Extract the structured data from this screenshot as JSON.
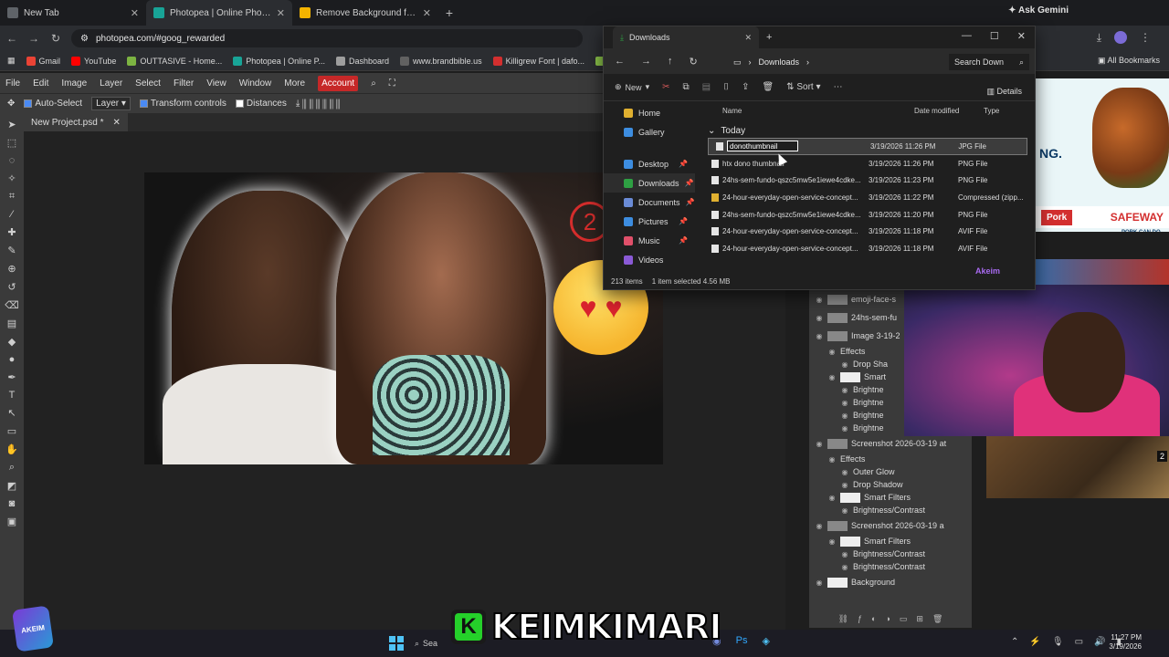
{
  "browser": {
    "tabs": [
      {
        "title": "New Tab",
        "color": "#5f6368"
      },
      {
        "title": "Photopea | Online Photo Editor",
        "color": "#18a497"
      },
      {
        "title": "Remove Background from Imag",
        "color": "#f4b400"
      }
    ],
    "gemini": "Ask Gemini",
    "url": "photopea.com/#goog_rewarded",
    "bookmarks": [
      {
        "label": "Gmail",
        "color": "#ea4335"
      },
      {
        "label": "YouTube",
        "color": "#ff0000"
      },
      {
        "label": "OUTTASIVE - Home...",
        "color": "#7cb342"
      },
      {
        "label": "Photopea | Online P...",
        "color": "#18a497"
      },
      {
        "label": "Dashboard",
        "color": "#9e9e9e"
      },
      {
        "label": "www.brandbible.us",
        "color": "#616161"
      },
      {
        "label": "Killigrew Font | dafo...",
        "color": "#d32f2f"
      },
      {
        "label": "3D Gif Mak",
        "color": "#8bc34a"
      }
    ],
    "all_bookmarks": "All Bookmarks"
  },
  "photopea": {
    "menu": [
      "File",
      "Edit",
      "Image",
      "Layer",
      "Select",
      "Filter",
      "View",
      "Window",
      "More"
    ],
    "account": "Account",
    "options": {
      "auto_select": "Auto-Select",
      "layer_select": "Layer",
      "transform_controls": "Transform controls",
      "distances": "Distances"
    },
    "doc_tab": "New Project.psd *"
  },
  "layers": [
    {
      "label": "emoji-face-s",
      "indent": 0,
      "kind": "layer"
    },
    {
      "label": "24hs-sem-fu",
      "indent": 0,
      "kind": "layer"
    },
    {
      "label": "Image 3-19-2",
      "indent": 0,
      "kind": "layer"
    },
    {
      "label": "Effects",
      "indent": 1,
      "kind": "fx"
    },
    {
      "label": "Drop Sha",
      "indent": 2,
      "kind": "fx"
    },
    {
      "label": "Smart",
      "indent": 1,
      "kind": "smart"
    },
    {
      "label": "Brightne",
      "indent": 2,
      "kind": "fx"
    },
    {
      "label": "Brightne",
      "indent": 2,
      "kind": "fx"
    },
    {
      "label": "Brightne",
      "indent": 2,
      "kind": "fx"
    },
    {
      "label": "Brightne",
      "indent": 2,
      "kind": "fx"
    },
    {
      "label": "Screenshot 2026-03-19 at",
      "indent": 0,
      "kind": "layer"
    },
    {
      "label": "Effects",
      "indent": 1,
      "kind": "fx"
    },
    {
      "label": "Outer Glow",
      "indent": 2,
      "kind": "fx"
    },
    {
      "label": "Drop Shadow",
      "indent": 2,
      "kind": "fx"
    },
    {
      "label": "Smart Filters",
      "indent": 1,
      "kind": "smart"
    },
    {
      "label": "Brightness/Contrast",
      "indent": 2,
      "kind": "fx"
    },
    {
      "label": "Screenshot 2026-03-19 a",
      "indent": 0,
      "kind": "layer"
    },
    {
      "label": "Smart Filters",
      "indent": 1,
      "kind": "smart"
    },
    {
      "label": "Brightness/Contrast",
      "indent": 2,
      "kind": "fx"
    },
    {
      "label": "Brightness/Contrast",
      "indent": 2,
      "kind": "fx"
    },
    {
      "label": "Background",
      "indent": 0,
      "kind": "bg"
    }
  ],
  "ad": {
    "headline": "NG.",
    "tagline": "TASTE WHAT PORK CAN DO",
    "pork": "Pork",
    "safeway": "SAFEWAY"
  },
  "game_badge": "2",
  "explorer": {
    "tab_title": "Downloads",
    "path": "Downloads",
    "search": "Search Down",
    "new_label": "New",
    "sort_label": "Sort",
    "details_label": "Details",
    "sidebar": [
      {
        "label": "Home",
        "color": "#e0b030",
        "pinned": false
      },
      {
        "label": "Gallery",
        "color": "#3d8de0",
        "pinned": false
      },
      {
        "label": "Desktop",
        "color": "#3d8de0",
        "pinned": true
      },
      {
        "label": "Downloads",
        "color": "#2ea043",
        "pinned": true
      },
      {
        "label": "Documents",
        "color": "#6a8bd6",
        "pinned": true
      },
      {
        "label": "Pictures",
        "color": "#3d8de0",
        "pinned": true
      },
      {
        "label": "Music",
        "color": "#e0506a",
        "pinned": true
      },
      {
        "label": "Videos",
        "color": "#8a5ad6",
        "pinned": false
      }
    ],
    "columns": {
      "name": "Name",
      "date": "Date modified",
      "type": "Type"
    },
    "group": "Today",
    "rename_value": "donothumbnail",
    "files": [
      {
        "name": "donothumbnail",
        "date": "3/19/2026 11:26 PM",
        "type": "JPG File",
        "zip": false,
        "renaming": true
      },
      {
        "name": "htx dono thumbnail",
        "date": "3/19/2026 11:26 PM",
        "type": "PNG File",
        "zip": false,
        "renaming": false
      },
      {
        "name": "24hs-sem-fundo-qszc5mw5e1iewe4cdke...",
        "date": "3/19/2026 11:23 PM",
        "type": "PNG File",
        "zip": false,
        "renaming": false
      },
      {
        "name": "24-hour-everyday-open-service-concept...",
        "date": "3/19/2026 11:22 PM",
        "type": "Compressed (zipp...",
        "zip": true,
        "renaming": false
      },
      {
        "name": "24hs-sem-fundo-qszc5mw5e1iewe4cdke...",
        "date": "3/19/2026 11:20 PM",
        "type": "PNG File",
        "zip": false,
        "renaming": false
      },
      {
        "name": "24-hour-everyday-open-service-concept...",
        "date": "3/19/2026 11:18 PM",
        "type": "AVIF File",
        "zip": false,
        "renaming": false
      },
      {
        "name": "24-hour-everyday-open-service-concept...",
        "date": "3/19/2026 11:18 PM",
        "type": "AVIF File",
        "zip": false,
        "renaming": false
      }
    ],
    "status_items": "213 items",
    "status_selected": "1 item selected  4.56 MB"
  },
  "taskbar": {
    "search": "Sea",
    "time": "11:27 PM",
    "date": "3/19/2026"
  },
  "overlay": {
    "streamer_badge": "K",
    "streamer_name": "KEIMKIMARI",
    "watermark": "AKEIM",
    "akeim": "Akeim"
  }
}
